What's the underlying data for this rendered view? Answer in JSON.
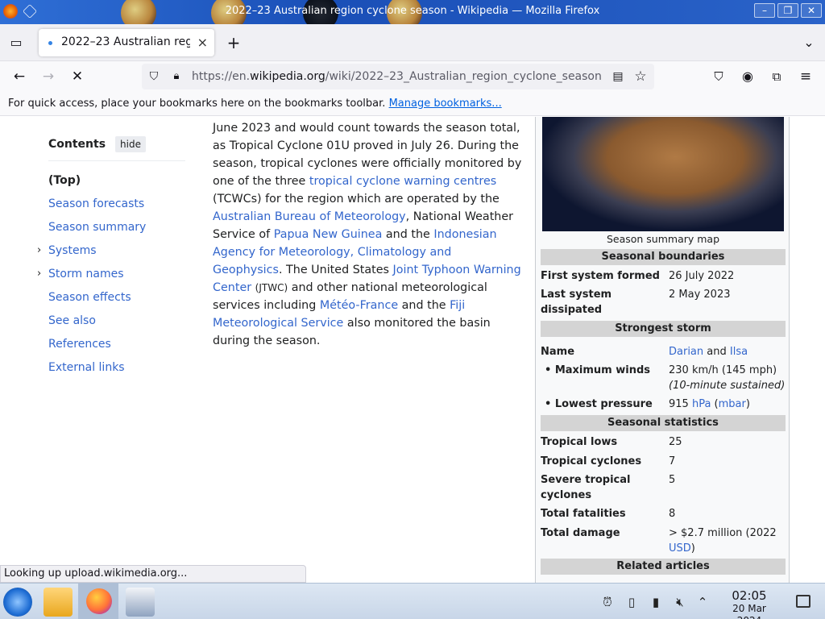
{
  "window": {
    "title": "2022–23 Australian region cyclone season - Wikipedia — Mozilla Firefox",
    "minimize": "–",
    "maximize": "❐",
    "close": "✕"
  },
  "tabs": [
    {
      "label": "2022–23 Australian regio",
      "close": "×"
    }
  ],
  "new_tab": "+",
  "nav": {
    "url_prefix": "https://en.",
    "url_domain": "wikipedia.org",
    "url_path": "/wiki/2022–23_Australian_region_cyclone_season"
  },
  "bookmarks_bar": {
    "text": "For quick access, place your bookmarks here on the bookmarks toolbar.",
    "link": "Manage bookmarks..."
  },
  "toc": {
    "title": "Contents",
    "hide": "hide",
    "items": [
      {
        "label": "(Top)"
      },
      {
        "label": "Season forecasts"
      },
      {
        "label": "Season summary"
      },
      {
        "label": "Systems"
      },
      {
        "label": "Storm names"
      },
      {
        "label": "Season effects"
      },
      {
        "label": "See also"
      },
      {
        "label": "References"
      },
      {
        "label": "External links"
      }
    ]
  },
  "article": {
    "t1": "June 2023 and would count towards the season total, as Tropical Cyclone 01U proved in July 26. During the season, tropical cyclones were officially monitored by one of the three ",
    "l1": "tropical cyclone warning centres",
    "t2": " (TCWCs) for the region which are operated by the ",
    "l2": "Australian Bureau of Meteorology",
    "t3": ", National Weather Service of ",
    "l3": "Papua New Guinea",
    "t4": " and the ",
    "l4": "Indonesian Agency for Meteorology, Climatology and Geophysics",
    "t5": ". The United States ",
    "l5": "Joint Typhoon Warning Center",
    "t6": "(JTWC)",
    "t7": " and other national meteorological services including ",
    "l6": "Météo-France",
    "t8": " and the ",
    "l7": "Fiji Meteorological Service",
    "t9": " also monitored the basin during the season."
  },
  "infobox": {
    "map_caption": "Season summary map",
    "boundaries_head": "Seasonal boundaries",
    "first_k": "First system formed",
    "first_v": "26 July 2022",
    "last_k": "Last system dissipated",
    "last_v": "2 May 2023",
    "storm_head": "Strongest storm",
    "name_k": "Name",
    "name_l1": "Darian",
    "name_and": " and ",
    "name_l2": "Ilsa",
    "winds_k": "• Maximum winds",
    "winds_v1": "230 km/h (145 mph)",
    "winds_v2": "(10-minute sustained)",
    "pressure_k": "• Lowest pressure",
    "pressure_v": "915 ",
    "pressure_l1": "hPa",
    "pressure_l2": "mbar",
    "stats_head": "Seasonal statistics",
    "lows_k": "Tropical lows",
    "lows_v": "25",
    "tc_k": "Tropical cyclones",
    "tc_v": "7",
    "stc_k": "Severe tropical cyclones",
    "stc_v": "5",
    "fatal_k": "Total fatalities",
    "fatal_v": "8",
    "damage_k": "Total damage",
    "damage_v": "> $2.7 million (2022 ",
    "damage_l": "USD",
    "related_head": "Related articles"
  },
  "status": "Looking up upload.wikimedia.org...",
  "clock": {
    "time": "02:05",
    "date": "20 Mar 2024"
  }
}
